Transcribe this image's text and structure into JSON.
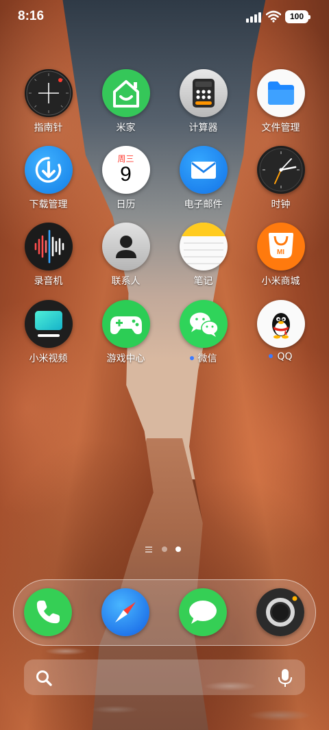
{
  "status_bar": {
    "time": "8:16",
    "battery": "100"
  },
  "apps": [
    {
      "label": "指南针"
    },
    {
      "label": "米家"
    },
    {
      "label": "计算器"
    },
    {
      "label": "文件管理"
    },
    {
      "label": "下载管理"
    },
    {
      "label": "日历",
      "weekday": "周三",
      "day": "9"
    },
    {
      "label": "电子邮件"
    },
    {
      "label": "时钟"
    },
    {
      "label": "录音机"
    },
    {
      "label": "联系人"
    },
    {
      "label": "笔记"
    },
    {
      "label": "小米商城",
      "badge": "MI"
    },
    {
      "label": "小米视频"
    },
    {
      "label": "游戏中心"
    },
    {
      "label": "微信",
      "new_dot": true
    },
    {
      "label": "QQ",
      "new_dot": true
    }
  ],
  "page_indicator": {
    "pages": 2,
    "current": 2
  },
  "dock": [
    {
      "name": "phone"
    },
    {
      "name": "browser"
    },
    {
      "name": "messages"
    },
    {
      "name": "camera"
    }
  ],
  "search": {
    "placeholder": ""
  },
  "colors": {
    "accent_blue": "#3c7bff",
    "mijia_green": "#35c759",
    "wechat_green": "#2fd45a",
    "mall_orange": "#ff7a0e"
  }
}
